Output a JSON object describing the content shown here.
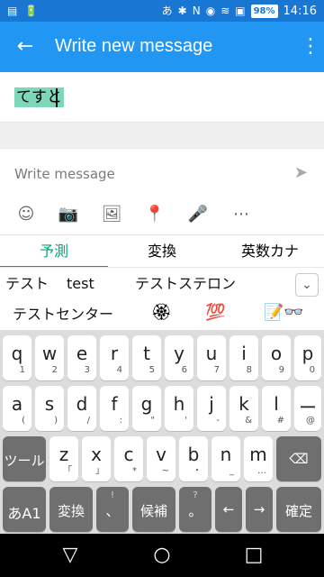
{
  "status": {
    "left": [
      "▤",
      "🔋"
    ],
    "right": [
      "あ",
      "✱",
      "N",
      "◉",
      "≋",
      "▣",
      "98%",
      "14:16"
    ],
    "battery_label": "98%",
    "time": "14:16"
  },
  "appbar": {
    "title": "Write new message",
    "back_icon": "←",
    "more_icon": "⋮"
  },
  "subject": {
    "text": "てすと"
  },
  "compose": {
    "placeholder": "Write message",
    "send_icon": "➤",
    "tools": [
      {
        "name": "sticker-icon",
        "glyph": "☺"
      },
      {
        "name": "camera-icon",
        "glyph": "📷"
      },
      {
        "name": "image-icon",
        "glyph": "🖼"
      },
      {
        "name": "location-icon",
        "glyph": "📍"
      },
      {
        "name": "mic-icon",
        "glyph": "🎤"
      },
      {
        "name": "more-options-icon",
        "glyph": "⋯"
      }
    ]
  },
  "ime": {
    "tabs": [
      "予測",
      "変換",
      "英数カナ"
    ]
  },
  "candidates": {
    "row1": [
      "テスト",
      "test",
      "テストステロン"
    ],
    "row2": [
      "テストセンター",
      "🏵",
      "💯",
      "📝👓"
    ]
  },
  "keyboard": {
    "row1": [
      {
        "m": "q",
        "s": "1"
      },
      {
        "m": "w",
        "s": "2"
      },
      {
        "m": "e",
        "s": "3"
      },
      {
        "m": "r",
        "s": "4"
      },
      {
        "m": "t",
        "s": "5"
      },
      {
        "m": "y",
        "s": "6"
      },
      {
        "m": "u",
        "s": "7"
      },
      {
        "m": "i",
        "s": "8"
      },
      {
        "m": "o",
        "s": "9"
      },
      {
        "m": "p",
        "s": "0"
      }
    ],
    "row2": [
      {
        "m": "a",
        "s": "("
      },
      {
        "m": "s",
        "s": ")"
      },
      {
        "m": "d",
        "s": "/"
      },
      {
        "m": "f",
        "s": ":"
      },
      {
        "m": "g",
        "s": "\""
      },
      {
        "m": "h",
        "s": "'"
      },
      {
        "m": "j",
        "s": "-"
      },
      {
        "m": "k",
        "s": "&"
      },
      {
        "m": "l",
        "s": "#"
      },
      {
        "m": "ー",
        "s": "@"
      }
    ],
    "row3": [
      {
        "m": "ツール",
        "s": ""
      },
      {
        "m": "z",
        "s": "「"
      },
      {
        "m": "x",
        "s": "」"
      },
      {
        "m": "c",
        "s": "*"
      },
      {
        "m": "v",
        "s": "~"
      },
      {
        "m": "b",
        "s": "・"
      },
      {
        "m": "n",
        "s": "_"
      },
      {
        "m": "m",
        "s": "…"
      },
      {
        "m": "⌫",
        "s": ""
      }
    ],
    "row4": [
      {
        "m": "あA1",
        "s": ""
      },
      {
        "m": "変換",
        "s": ""
      },
      {
        "m": "、",
        "s": "!"
      },
      {
        "m": "候補",
        "s": ""
      },
      {
        "m": "。",
        "s": "?"
      },
      {
        "m": "←",
        "s": ""
      },
      {
        "m": "→",
        "s": ""
      },
      {
        "m": "確定",
        "s": ""
      }
    ]
  },
  "nav": {
    "back": "▽",
    "home": "○",
    "recents": "□"
  }
}
